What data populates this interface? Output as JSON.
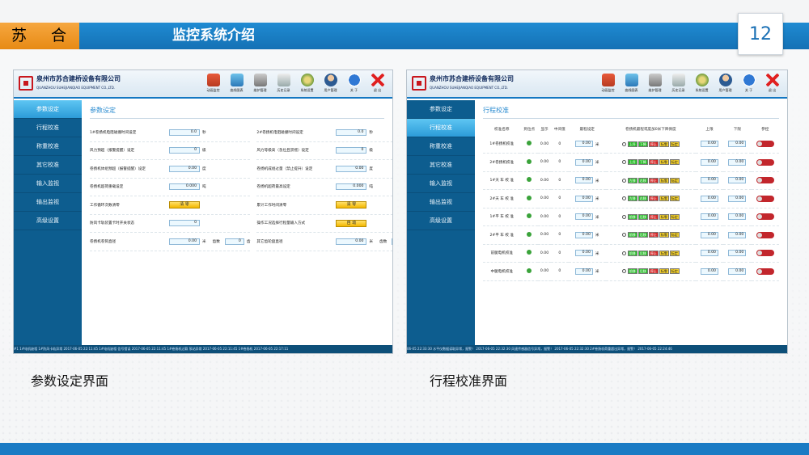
{
  "slide": {
    "brand": "苏 合",
    "title": "监控系统介绍",
    "page_number": "12",
    "captions": [
      "参数设定界面",
      "行程校准界面"
    ]
  },
  "app": {
    "company_cn": "泉州市苏合建桥设备有限公司",
    "company_en": "QUANZHOU SUHEJIANQIAO EQUIPMENT CO.,LTD.",
    "toolbar": [
      {
        "label": "动画监控",
        "icon": "home-icon"
      },
      {
        "label": "曲线图表",
        "icon": "monitor-icon"
      },
      {
        "label": "维护管理",
        "icon": "tools-icon"
      },
      {
        "label": "历史记录",
        "icon": "history-icon"
      },
      {
        "label": "系统设置",
        "icon": "settings-icon"
      },
      {
        "label": "用户管理",
        "icon": "user-icon"
      },
      {
        "label": "关 于",
        "icon": "info-icon"
      },
      {
        "label": "退 出",
        "icon": "exit-icon"
      }
    ],
    "sidebar": [
      "参数设定",
      "行程校准",
      "称重校准",
      "其它校准",
      "输入监视",
      "输出监视",
      "高级设置"
    ]
  },
  "left_screen": {
    "title": "参数设定",
    "rows": [
      [
        {
          "label": "1#卷扬机电阻碰撞时间设定",
          "value": "0.0",
          "unit": "秒"
        },
        {
          "label": "2#卷扬机电阻碰撞时间设定",
          "value": "0.0",
          "unit": "秒"
        }
      ],
      [
        {
          "label": "风力预超（报警提醒）设定",
          "value": "0",
          "unit": "级"
        },
        {
          "label": "风力等级高（急位且禁摇）设定",
          "value": "0",
          "unit": "级"
        }
      ],
      [
        {
          "label": "卷扬机体组预超（报警提醒）设定",
          "value": "0.00",
          "unit": "度"
        },
        {
          "label": "卷扬机成组过量（禁止提升）设定",
          "value": "0.00",
          "unit": "度"
        }
      ],
      [
        {
          "label": "卷扬机超荷重载设定",
          "value": "0.000",
          "unit": "吨"
        },
        {
          "label": "卷扬机超荷最高设定",
          "value": "0.000",
          "unit": "吨"
        }
      ],
      [
        {
          "label": "工作循环次数清零",
          "button": "清 零"
        },
        {
          "label": "累计工作时间清零",
          "button": "清 零"
        }
      ],
      [
        {
          "label": "防风卡轨装置卡时开关状态",
          "value": "0",
          "unit": ""
        },
        {
          "label": "操作工况选择行程量输入方式",
          "button": "自 动"
        }
      ],
      [
        {
          "label": "卷扬机卷筒直径",
          "value": "0.00",
          "unit": "米",
          "extra_label": "齿数",
          "extra_value": "0",
          "extra_unit": "齿"
        },
        {
          "label": "其它齿轮盘直径",
          "value": "0.00",
          "unit": "米",
          "extra_label": "齿数",
          "extra_value": "0",
          "extra_unit": "齿"
        }
      ]
    ],
    "ticker": "#1 1#电机缺相 1#防风卡轨异常 2017-06-05 22:11:45 1#电机缺相 信号错误 2017-06-05 22:11:45 1#卷扬机过载 泵站异常 2017-06-05 22:11:45 1#卷扬机 2017-06-05 22:17:11"
  },
  "right_screen": {
    "title": "行程校准",
    "columns": [
      "校准名称",
      "到位点",
      "显示",
      "中间值",
      "最程设定",
      "卷扬机最程或度加0米下降保度",
      "上限",
      "下限",
      "参控"
    ],
    "rows": [
      {
        "name": "1#卷扬机校准",
        "display": "0.00",
        "mid": "0",
        "set": "0.00",
        "unit": "米",
        "buttons": [
          [
            "上升",
            "gr"
          ],
          [
            "下降",
            "gr"
          ],
          [
            "停止",
            "rd"
          ],
          [
            "标零",
            "yl"
          ],
          [
            "标定",
            "yl"
          ]
        ],
        "upper": "0.00",
        "lower": "0.00"
      },
      {
        "name": "2#卷扬机校准",
        "display": "0.00",
        "mid": "0",
        "set": "0.00",
        "unit": "米",
        "buttons": [
          [
            "上升",
            "gr"
          ],
          [
            "下降",
            "gr"
          ],
          [
            "停止",
            "rd"
          ],
          [
            "标零",
            "yl"
          ],
          [
            "标定",
            "yl"
          ]
        ],
        "upper": "0.00",
        "lower": "0.00"
      },
      {
        "name": "1#天 车 校 准",
        "display": "0.00",
        "mid": "0",
        "set": "0.00",
        "unit": "米",
        "buttons": [
          [
            "左移",
            "gr"
          ],
          [
            "右移",
            "gr"
          ],
          [
            "停止",
            "rd"
          ],
          [
            "标零",
            "yl"
          ],
          [
            "标定",
            "yl"
          ]
        ],
        "upper": "0.00",
        "lower": "0.00"
      },
      {
        "name": "2#天 车 校 准",
        "display": "0.00",
        "mid": "0",
        "set": "0.00",
        "unit": "米",
        "buttons": [
          [
            "左移",
            "gr"
          ],
          [
            "右移",
            "gr"
          ],
          [
            "停止",
            "rd"
          ],
          [
            "标零",
            "yl"
          ],
          [
            "标定",
            "yl"
          ]
        ],
        "upper": "0.00",
        "lower": "0.00"
      },
      {
        "name": "1#平 车 校 准",
        "display": "0.00",
        "mid": "0",
        "set": "0.00",
        "unit": "米",
        "buttons": [
          [
            "前移",
            "gr"
          ],
          [
            "后移",
            "gr"
          ],
          [
            "停止",
            "rd"
          ],
          [
            "标零",
            "yl"
          ],
          [
            "标定",
            "yl"
          ]
        ],
        "upper": "0.00",
        "lower": "0.00"
      },
      {
        "name": "2#平 车 校 准",
        "display": "0.00",
        "mid": "0",
        "set": "0.00",
        "unit": "米",
        "buttons": [
          [
            "前移",
            "gr"
          ],
          [
            "后移",
            "gr"
          ],
          [
            "停止",
            "rd"
          ],
          [
            "标零",
            "yl"
          ],
          [
            "标定",
            "yl"
          ]
        ],
        "upper": "0.00",
        "lower": "0.00"
      },
      {
        "name": "前腿电机校准",
        "display": "0.00",
        "mid": "0",
        "set": "0.00",
        "unit": "米",
        "buttons": [
          [
            "前移",
            "gr"
          ],
          [
            "后移",
            "gr"
          ],
          [
            "停止",
            "rd"
          ],
          [
            "标零",
            "yl"
          ],
          [
            "标定",
            "yl"
          ]
        ],
        "upper": "0.00",
        "lower": "0.00"
      },
      {
        "name": "中腿电机校准",
        "display": "0.00",
        "mid": "0",
        "set": "0.00",
        "unit": "米",
        "buttons": [
          [
            "前移",
            "gr"
          ],
          [
            "后移",
            "gr"
          ],
          [
            "停止",
            "rd"
          ],
          [
            "标零",
            "yl"
          ],
          [
            "标定",
            "yl"
          ]
        ],
        "upper": "0.00",
        "lower": "0.00"
      }
    ],
    "ticker": "06-05 22:33:30 水平仪数据读取异常，报警！ 2017-06-05 22:32:30 风速传感器信号异常，报警！ 2017-06-05 22:32:30 2#卷扬机荷重超出异常，报警！ 2017-06-05 22:24:46"
  }
}
